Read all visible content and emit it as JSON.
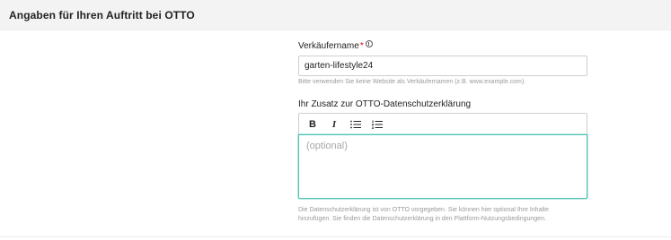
{
  "section": {
    "title": "Angaben für Ihren Auftritt bei OTTO"
  },
  "seller_name": {
    "label": "Verkäufername",
    "required_mark": "*",
    "value": "garten-lifestyle24",
    "hint": "Bitte verwenden Sie keine Website als Verkäufernamen (z.B. www.example.com)."
  },
  "privacy_addition": {
    "label": "Ihr Zusatz zur OTTO-Datenschutzerklärung",
    "toolbar": {
      "bold": "B",
      "italic": "I",
      "bullet_list": "☰",
      "numbered_list": "☷"
    },
    "placeholder": "(optional)",
    "hint_line1": "Die Datenschutzerklärung ist von OTTO vorgegeben. Sie können hier optional Ihre Inhalte",
    "hint_line2": "hinzufügen. Sie finden die Datenschutzerklärung in den Plattform-Nutzungsbedingungen."
  },
  "colors": {
    "header_bg": "#f3f3f3",
    "focus_border": "#4fc3b4",
    "required": "#e2001a"
  }
}
